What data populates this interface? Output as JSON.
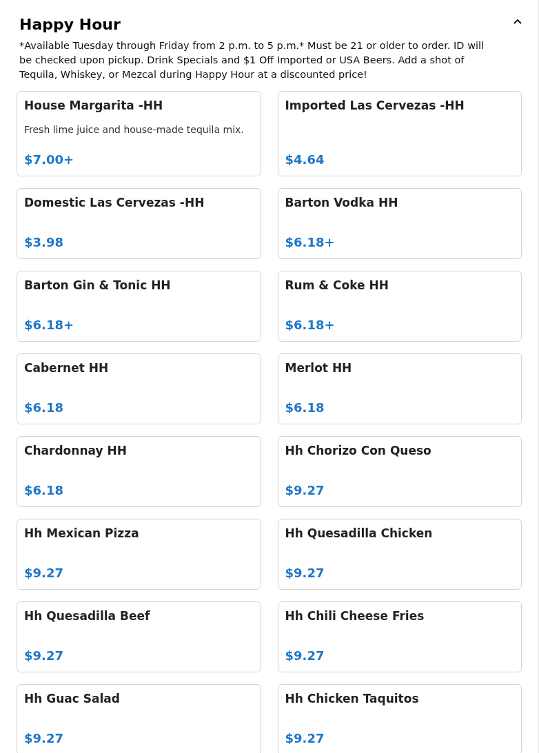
{
  "section": {
    "title": "Happy Hour",
    "expanded": true,
    "description": "*Available Tuesday through Friday from 2 p.m. to 5 p.m.* Must be 21 or older to order. ID will be checked upon pickup. Drink Specials and $1 Off Imported or USA Beers. Add a shot of Tequila, Whiskey, or Mezcal during Happy Hour at a discounted price!"
  },
  "items": [
    {
      "name": "House Margarita -HH",
      "description": "Fresh lime juice and house-made tequila mix.",
      "price": "$7.00+"
    },
    {
      "name": "Imported Las Cervezas -HH",
      "price": "$4.64"
    },
    {
      "name": "Domestic Las Cervezas -HH",
      "price": "$3.98"
    },
    {
      "name": "Barton Vodka HH",
      "price": "$6.18+"
    },
    {
      "name": "Barton Gin & Tonic HH",
      "price": "$6.18+"
    },
    {
      "name": "Rum & Coke HH",
      "price": "$6.18+"
    },
    {
      "name": "Cabernet HH",
      "price": "$6.18"
    },
    {
      "name": "Merlot HH",
      "price": "$6.18"
    },
    {
      "name": "Chardonnay HH",
      "price": "$6.18"
    },
    {
      "name": "Hh Chorizo Con Queso",
      "price": "$9.27"
    },
    {
      "name": "Hh Mexican Pizza",
      "price": "$9.27"
    },
    {
      "name": "Hh Quesadilla Chicken",
      "price": "$9.27"
    },
    {
      "name": "Hh Quesadilla Beef",
      "price": "$9.27"
    },
    {
      "name": "Hh Chili Cheese Fries",
      "price": "$9.27"
    },
    {
      "name": "Hh Guac Salad",
      "price": "$9.27"
    },
    {
      "name": "Hh Chicken Taquitos",
      "price": "$9.27"
    }
  ]
}
